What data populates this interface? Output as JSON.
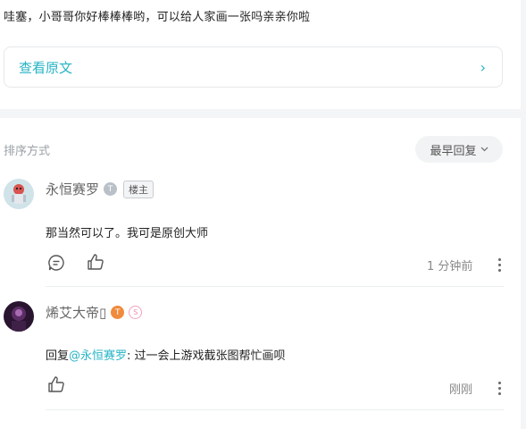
{
  "post": {
    "text": "哇塞，小哥哥你好棒棒棒哟，可以给人家画一张吗亲亲你啦",
    "view_original_label": "查看原文",
    "view_original_chevron": "›"
  },
  "sort": {
    "label": "排序方式",
    "selected": "最早回复",
    "chevron": "⌄"
  },
  "comments": [
    {
      "username": "永恒赛罗",
      "level_badge": "T",
      "owner_tag": "楼主",
      "body": "那当然可以了。我可是原创大师",
      "time": "1 分钟前",
      "icons": [
        "comment-icon",
        "like-icon",
        "more-icon"
      ]
    },
    {
      "username": "烯艾大帝",
      "username_suffix": "▯",
      "level_badge": "T",
      "extra_badge": "S",
      "reply_prefix": "回复",
      "mention": "@永恒赛罗",
      "body": ": 过一会上游戏截张图帮忙画呗",
      "time": "刚刚",
      "icons": [
        "like-icon",
        "more-icon"
      ]
    }
  ],
  "colors": {
    "accent": "#27b3c5",
    "level_badge": "#f08a3c",
    "extra_badge": "#f2a3b8",
    "muted": "#888888"
  }
}
